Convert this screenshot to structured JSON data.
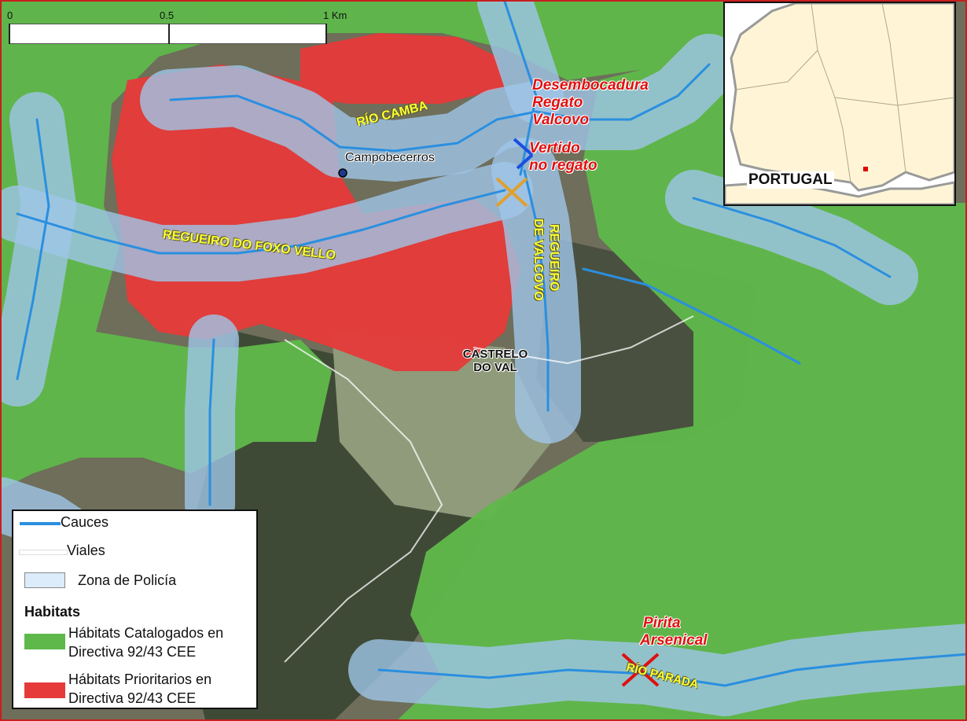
{
  "scalebar": {
    "tick_0": "0",
    "tick_mid": "0.5",
    "tick_end": "1 Km"
  },
  "labels": {
    "rio_camba": "RÍO CAMBA",
    "campobecerros": "Campobecerros",
    "regueiro_foxo_vello": "REGUEIRO DO FOXO VELLO",
    "regueiro_valcovo_line1": "REGUEIRO",
    "regueiro_valcovo_line2": "DE VALCOVO",
    "castrelo_line1": "CASTRELO",
    "castrelo_line2": "DO VAL",
    "desembocadura_line1": "Desembocadura",
    "desembocadura_line2": "Regato",
    "desembocadura_line3": "Valcovo",
    "vertido_line1": "Vertido",
    "vertido_line2": "no regato",
    "pirita_line1": "Pirita",
    "pirita_line2": "Arsenical",
    "rio_parada": "RÍO PARADA"
  },
  "inset": {
    "country_label": "PORTUGAL",
    "land_color": "#fff5d6",
    "sea_color": "#ffffff",
    "marker_color": "#e00000"
  },
  "legend": {
    "cauces": "Cauces",
    "viales": "Viales",
    "zona_policia": "Zona de Policía",
    "habitats_title": "Habitats",
    "catalogados_line1": "Hábitats Catalogados en",
    "catalogados_line2": "Directiva 92/43 CEE",
    "prioritarios_line1": "Hábitats Prioritarios en",
    "prioritarios_line2": "Directiva 92/43 CEE"
  },
  "colors": {
    "habitat_catalogado": "#5fb84a",
    "habitat_prioritario": "#e63a3a",
    "zona_policia": "#9fc6e8",
    "cauces": "#2a8fe0",
    "viales": "#ffffff",
    "vertido_marker": "#1a4fe0",
    "point_marker": "#e0a030",
    "pirita_marker": "#e01010"
  }
}
